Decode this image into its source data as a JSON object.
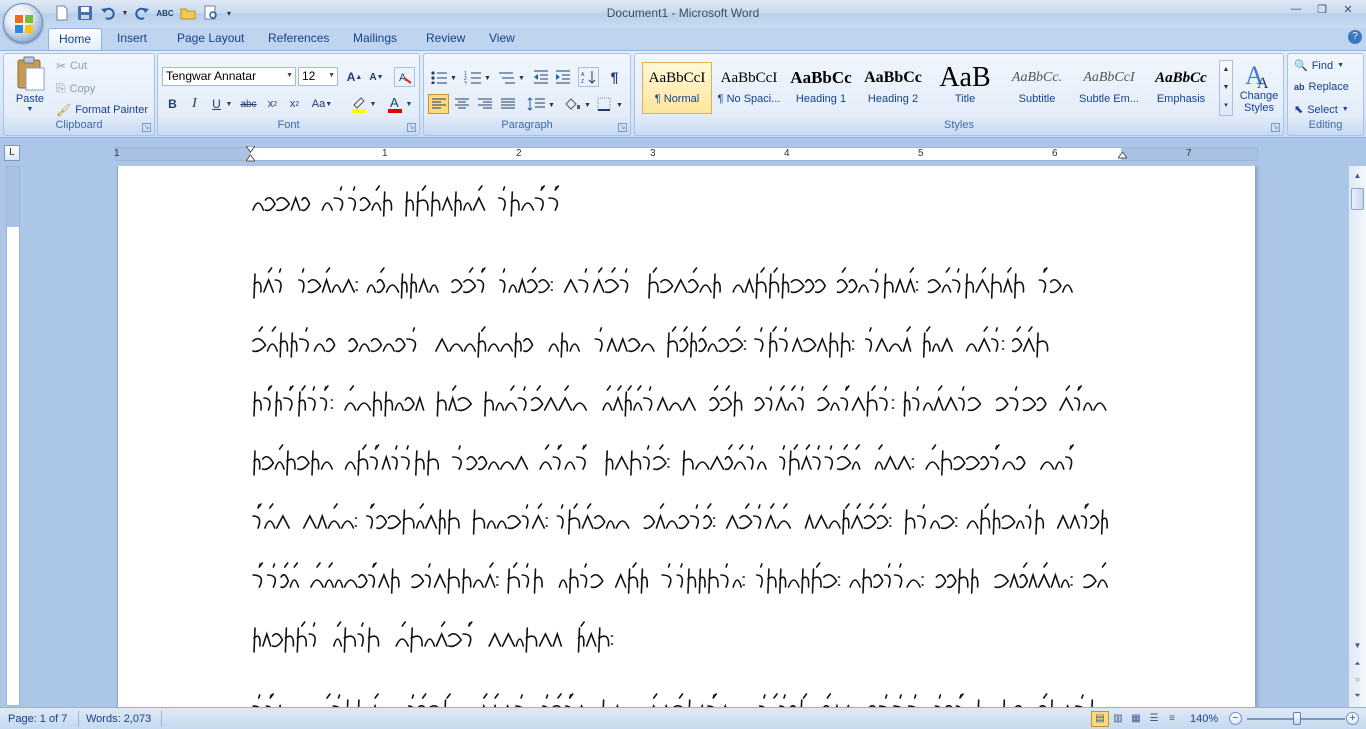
{
  "window": {
    "title": "Document1 - Microsoft Word"
  },
  "quick_access": {
    "icons": [
      "save-icon",
      "undo-icon",
      "redo-icon",
      "spelling-icon",
      "open-icon",
      "print-preview-icon",
      "customize-icon"
    ]
  },
  "tabs": [
    "Home",
    "Insert",
    "Page Layout",
    "References",
    "Mailings",
    "Review",
    "View"
  ],
  "active_tab": "Home",
  "clipboard": {
    "label": "Clipboard",
    "paste": "Paste",
    "cut": "Cut",
    "copy": "Copy",
    "format_painter": "Format Painter"
  },
  "font": {
    "label": "Font",
    "name": "Tengwar Annatar",
    "size": "12"
  },
  "paragraph": {
    "label": "Paragraph"
  },
  "styles": {
    "label": "Styles",
    "items": [
      {
        "sample": "AaBbCcI",
        "name": "¶ Normal"
      },
      {
        "sample": "AaBbCcI",
        "name": "¶ No Spaci..."
      },
      {
        "sample": "AaBbCc",
        "name": "Heading 1"
      },
      {
        "sample": "AaBbCc",
        "name": "Heading 2"
      },
      {
        "sample": "AaB",
        "name": "Title"
      },
      {
        "sample": "AaBbCc.",
        "name": "Subtitle"
      },
      {
        "sample": "AaBbCcI",
        "name": "Subtle Em..."
      },
      {
        "sample": "AaBbCc",
        "name": "Emphasis"
      }
    ],
    "change_styles": "Change Styles"
  },
  "editing": {
    "label": "Editing",
    "find": "Find",
    "replace": "Replace",
    "select": "Select"
  },
  "ruler": {
    "numbers": [
      "1",
      "1",
      "2",
      "3",
      "4",
      "5",
      "6",
      "7"
    ]
  },
  "status": {
    "page": "Page: 1 of 7",
    "words": "Words: 2,073",
    "zoom": "140%"
  },
  "colors": {
    "accent": "#15428b",
    "ribbon_bg": "#dae6f5",
    "page_bg": "#ffffff",
    "workspace": "#abc6e6",
    "highlight_yellow": "#ffff00",
    "font_red": "#e00000"
  }
}
